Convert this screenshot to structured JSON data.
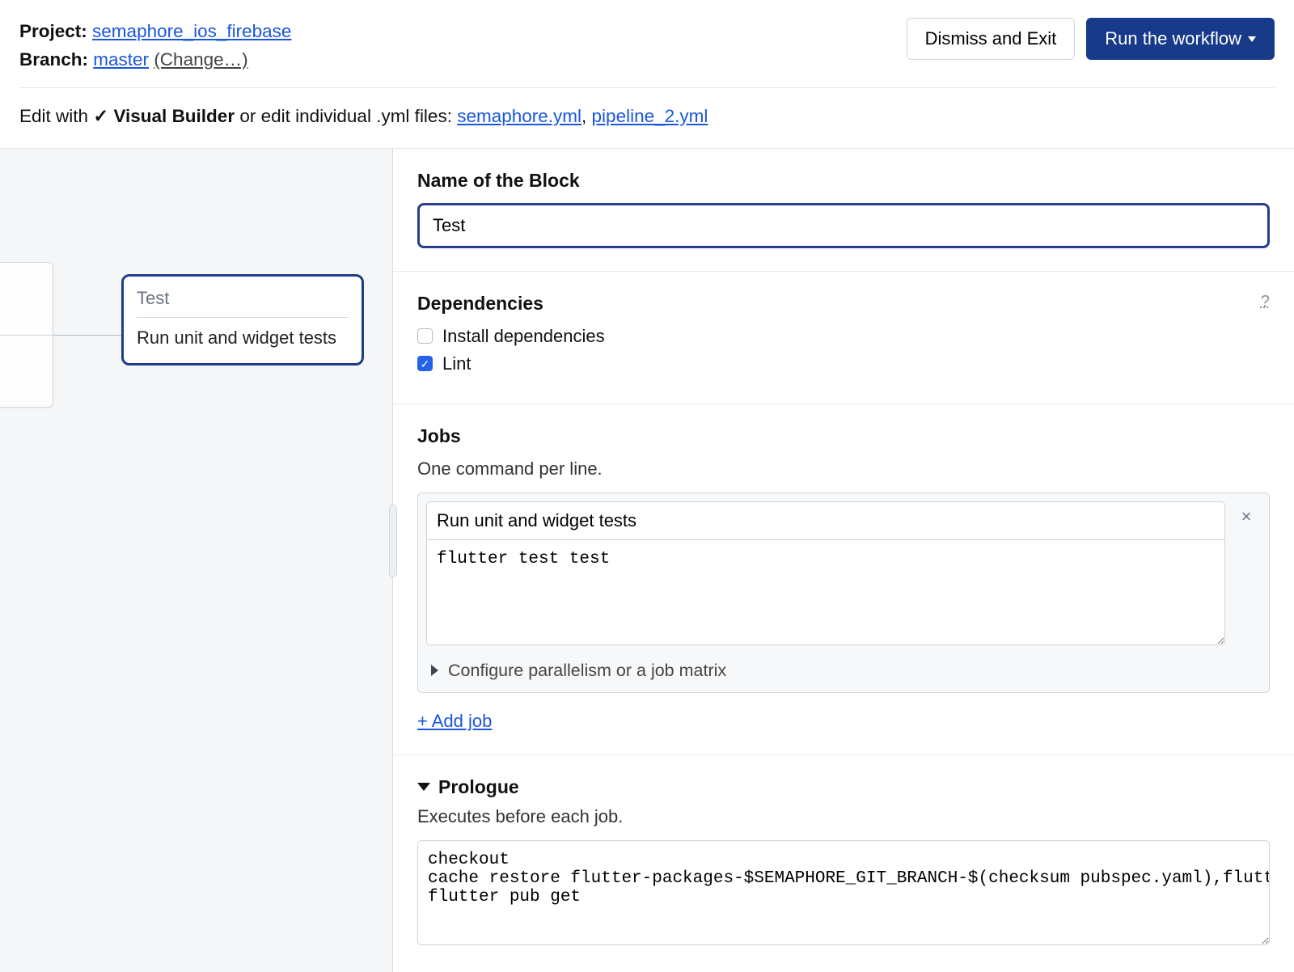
{
  "header": {
    "project_label": "Project:",
    "project_name": "semaphore_ios_firebase",
    "branch_label": "Branch:",
    "branch_name": "master",
    "change_label": "(Change…)",
    "dismiss_label": "Dismiss and Exit",
    "run_label": "Run the workflow"
  },
  "editrow": {
    "prefix": "Edit with",
    "visual_builder": "Visual Builder",
    "midfix": "or edit individual .yml files:",
    "file1": "semaphore.yml",
    "file2": "pipeline_2.yml"
  },
  "canvas": {
    "block_title": "Test",
    "block_job": "Run unit and widget tests"
  },
  "block": {
    "name_label": "Name of the Block",
    "name_value": "Test"
  },
  "dependencies": {
    "label": "Dependencies",
    "help": "?",
    "items": [
      {
        "label": "Install dependencies",
        "checked": false
      },
      {
        "label": "Lint",
        "checked": true
      }
    ]
  },
  "jobs": {
    "label": "Jobs",
    "sub": "One command per line.",
    "job_name": "Run unit and widget tests",
    "job_commands": "flutter test test",
    "configure_label": "Configure parallelism or a job matrix",
    "add_job_label": "+ Add job",
    "remove_icon": "×"
  },
  "prologue": {
    "label": "Prologue",
    "sub": "Executes before each job.",
    "commands": "checkout\ncache restore flutter-packages-$SEMAPHORE_GIT_BRANCH-$(checksum pubspec.yaml),flutter-packages-\nflutter pub get"
  }
}
